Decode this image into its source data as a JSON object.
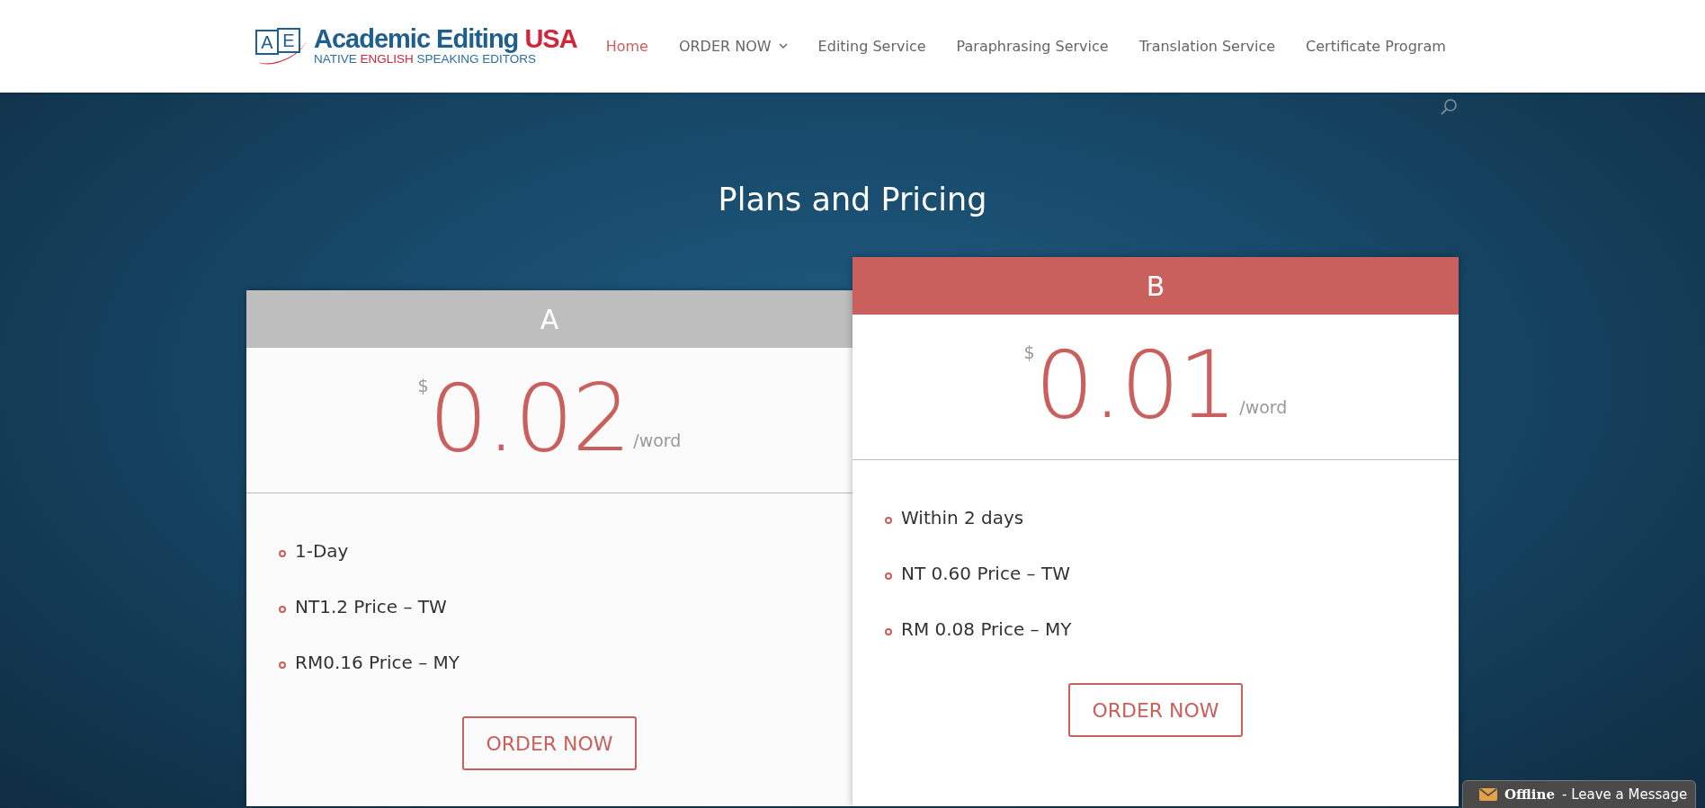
{
  "header": {
    "logo": {
      "letters": [
        "A",
        "E"
      ],
      "title": [
        {
          "text": "Academic Editing ",
          "accent": false
        },
        {
          "text": "USA",
          "accent": true
        }
      ],
      "tagline": [
        {
          "text": "NATIVE ",
          "accent": false
        },
        {
          "text": "ENGLISH",
          "accent": true
        },
        {
          "text": " SPEAKING EDITORS",
          "accent": false
        }
      ]
    },
    "nav": [
      {
        "label": "Home",
        "selected": true,
        "dropdown": false
      },
      {
        "label": "ORDER NOW",
        "selected": false,
        "dropdown": true
      },
      {
        "label": "Editing Service",
        "selected": false,
        "dropdown": false
      },
      {
        "label": "Paraphrasing Service",
        "selected": false,
        "dropdown": false
      },
      {
        "label": "Translation Service",
        "selected": false,
        "dropdown": false
      },
      {
        "label": "Certificate Program",
        "selected": false,
        "dropdown": false
      }
    ]
  },
  "pricing": {
    "title": "Plans and Pricing",
    "plans": [
      {
        "name": "A",
        "featured": false,
        "currency": "$",
        "price": "0.02",
        "unit": "/word",
        "features": [
          "1-Day",
          "NT1.2 Price – TW",
          "RM0.16 Price – MY"
        ],
        "button": "ORDER NOW"
      },
      {
        "name": "B",
        "featured": true,
        "currency": "$",
        "price": "0.01",
        "unit": "/word",
        "features": [
          "Within 2 days",
          "NT 0.60 Price – TW",
          "RM 0.08 Price – MY"
        ],
        "button": "ORDER NOW"
      }
    ]
  },
  "chat_widget": {
    "status": "Offline",
    "message": "- Leave a Message"
  }
}
